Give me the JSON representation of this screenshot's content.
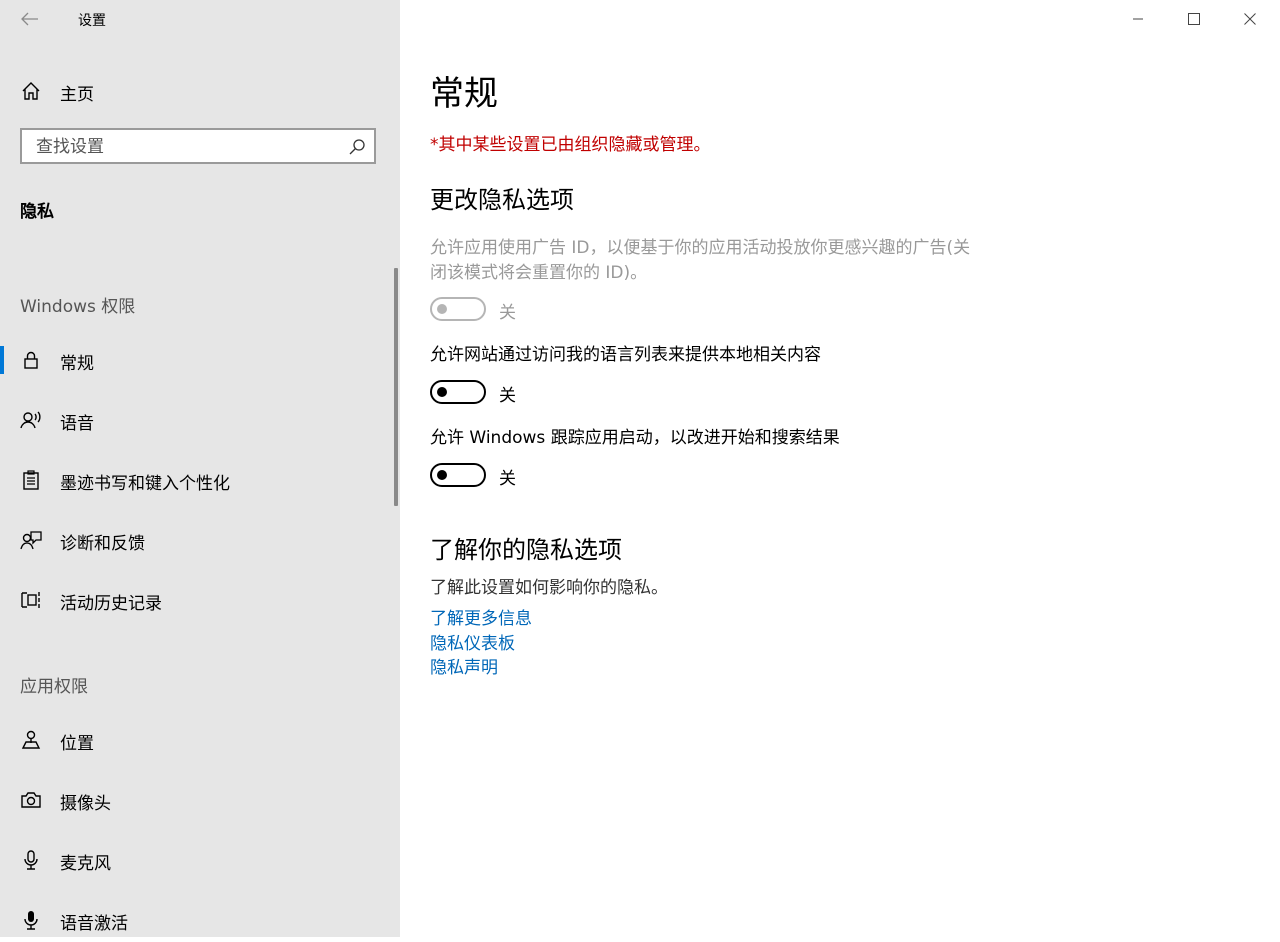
{
  "window": {
    "title": "设置",
    "controls": [
      "minimize-icon",
      "maximize-icon",
      "close-icon"
    ]
  },
  "sidebar": {
    "home_label": "主页",
    "search_placeholder": "查找设置",
    "section_title": "隐私",
    "groups": [
      {
        "label": "Windows 权限"
      },
      {
        "label": "应用权限"
      }
    ],
    "items": [
      {
        "label": "常规",
        "icon": "lock-icon",
        "active": true
      },
      {
        "label": "语音",
        "icon": "speech-icon"
      },
      {
        "label": "墨迹书写和键入个性化",
        "icon": "clipboard-icon"
      },
      {
        "label": "诊断和反馈",
        "icon": "feedback-icon"
      },
      {
        "label": "活动历史记录",
        "icon": "timeline-icon"
      },
      {
        "label": "位置",
        "icon": "location-icon"
      },
      {
        "label": "摄像头",
        "icon": "camera-icon"
      },
      {
        "label": "麦克风",
        "icon": "microphone-icon"
      },
      {
        "label": "语音激活",
        "icon": "microphone-filled-icon"
      }
    ]
  },
  "main": {
    "title": "常规",
    "org_warning": "*其中某些设置已由组织隐藏或管理。",
    "section1_heading": "更改隐私选项",
    "settings": [
      {
        "desc": "允许应用使用广告 ID，以便基于你的应用活动投放你更感兴趣的广告(关",
        "desc2": "闭该模式将会重置你的 ID)。",
        "state": "关",
        "enabled": false
      },
      {
        "desc": "允许网站通过访问我的语言列表来提供本地相关内容",
        "state": "关",
        "enabled": true
      },
      {
        "desc": "允许 Windows 跟踪应用启动，以改进开始和搜索结果",
        "state": "关",
        "enabled": true
      }
    ],
    "section2_heading": "了解你的隐私选项",
    "section2_desc": "了解此设置如何影响你的隐私。",
    "links": [
      "了解更多信息",
      "隐私仪表板",
      "隐私声明"
    ]
  },
  "colors": {
    "accent": "#0078d7",
    "link": "#0067b8",
    "warning": "#c00000",
    "sidebar_bg": "#e6e6e6"
  }
}
